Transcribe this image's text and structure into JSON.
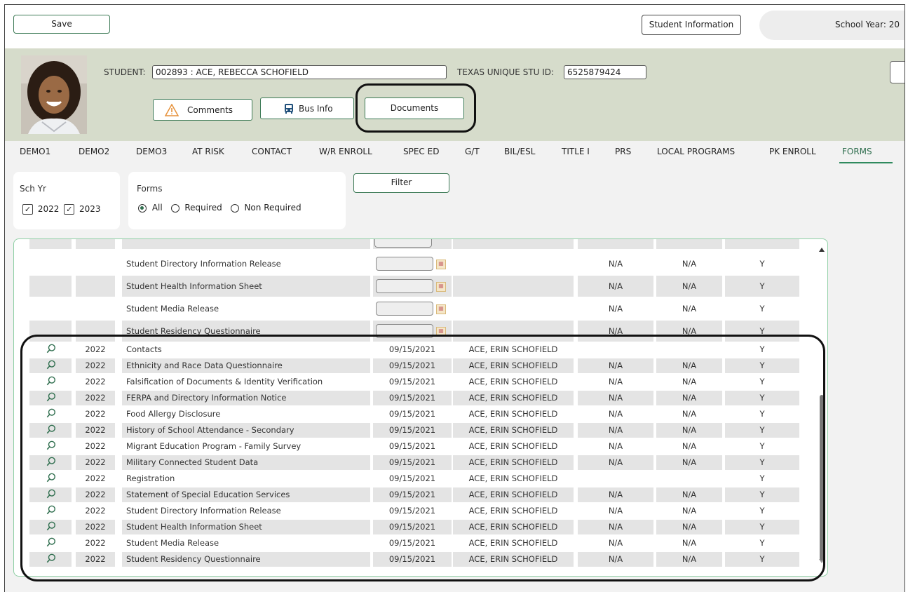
{
  "toolbar": {
    "save_label": "Save",
    "student_info_label": "Student Information",
    "school_year_text": "School Year: 20"
  },
  "student": {
    "student_label": "STUDENT:",
    "student_value": "002893 : ACE, REBECCA SCHOFIELD",
    "unique_id_label": "TEXAS UNIQUE STU ID:",
    "unique_id_value": "6525879424",
    "comments_label": "Comments",
    "bus_info_label": "Bus Info",
    "documents_label": "Documents"
  },
  "tabs": [
    "DEMO1",
    "DEMO2",
    "DEMO3",
    "AT RISK",
    "CONTACT",
    "W/R ENROLL",
    "SPEC ED",
    "G/T",
    "BIL/ESL",
    "TITLE I",
    "PRS",
    "LOCAL PROGRAMS",
    "PK ENROLL",
    "FORMS"
  ],
  "active_tab": "FORMS",
  "filters": {
    "sch_yr_label": "Sch Yr",
    "years": [
      {
        "label": "2022",
        "checked": true
      },
      {
        "label": "2023",
        "checked": true
      }
    ],
    "forms_label": "Forms",
    "form_options": [
      {
        "label": "All",
        "selected": true
      },
      {
        "label": "Required",
        "selected": false
      },
      {
        "label": "Non Required",
        "selected": false
      }
    ],
    "filter_button": "Filter"
  },
  "top_rows": [
    {
      "form": "Student Directory Information Release",
      "col1": "N/A",
      "col2": "N/A",
      "col3": "Y"
    },
    {
      "form": "Student Health Information Sheet",
      "col1": "N/A",
      "col2": "N/A",
      "col3": "Y"
    },
    {
      "form": "Student Media Release",
      "col1": "N/A",
      "col2": "N/A",
      "col3": "Y"
    },
    {
      "form": "Student Residency Questionnaire",
      "col1": "N/A",
      "col2": "N/A",
      "col3": "Y"
    }
  ],
  "rows": [
    {
      "year": "2022",
      "form": "Contacts",
      "date": "09/15/2021",
      "by": "ACE, ERIN SCHOFIELD",
      "col1": "",
      "col2": "",
      "col3": "Y"
    },
    {
      "year": "2022",
      "form": "Ethnicity and Race Data Questionnaire",
      "date": "09/15/2021",
      "by": "ACE, ERIN SCHOFIELD",
      "col1": "N/A",
      "col2": "N/A",
      "col3": "Y"
    },
    {
      "year": "2022",
      "form": "Falsification of Documents & Identity Verification",
      "date": "09/15/2021",
      "by": "ACE, ERIN SCHOFIELD",
      "col1": "N/A",
      "col2": "N/A",
      "col3": "Y"
    },
    {
      "year": "2022",
      "form": "FERPA and Directory Information Notice",
      "date": "09/15/2021",
      "by": "ACE, ERIN SCHOFIELD",
      "col1": "N/A",
      "col2": "N/A",
      "col3": "Y"
    },
    {
      "year": "2022",
      "form": "Food Allergy Disclosure",
      "date": "09/15/2021",
      "by": "ACE, ERIN SCHOFIELD",
      "col1": "N/A",
      "col2": "N/A",
      "col3": "Y"
    },
    {
      "year": "2022",
      "form": "History of School Attendance - Secondary",
      "date": "09/15/2021",
      "by": "ACE, ERIN SCHOFIELD",
      "col1": "N/A",
      "col2": "N/A",
      "col3": "Y"
    },
    {
      "year": "2022",
      "form": "Migrant Education Program - Family Survey",
      "date": "09/15/2021",
      "by": "ACE, ERIN SCHOFIELD",
      "col1": "N/A",
      "col2": "N/A",
      "col3": "Y"
    },
    {
      "year": "2022",
      "form": "Military Connected Student Data",
      "date": "09/15/2021",
      "by": "ACE, ERIN SCHOFIELD",
      "col1": "N/A",
      "col2": "N/A",
      "col3": "Y"
    },
    {
      "year": "2022",
      "form": "Registration",
      "date": "09/15/2021",
      "by": "ACE, ERIN SCHOFIELD",
      "col1": "",
      "col2": "",
      "col3": "Y"
    },
    {
      "year": "2022",
      "form": "Statement of Special Education Services",
      "date": "09/15/2021",
      "by": "ACE, ERIN SCHOFIELD",
      "col1": "N/A",
      "col2": "N/A",
      "col3": "Y"
    },
    {
      "year": "2022",
      "form": "Student Directory Information Release",
      "date": "09/15/2021",
      "by": "ACE, ERIN SCHOFIELD",
      "col1": "N/A",
      "col2": "N/A",
      "col3": "Y"
    },
    {
      "year": "2022",
      "form": "Student Health Information Sheet",
      "date": "09/15/2021",
      "by": "ACE, ERIN SCHOFIELD",
      "col1": "N/A",
      "col2": "N/A",
      "col3": "Y"
    },
    {
      "year": "2022",
      "form": "Student Media Release",
      "date": "09/15/2021",
      "by": "ACE, ERIN SCHOFIELD",
      "col1": "N/A",
      "col2": "N/A",
      "col3": "Y"
    },
    {
      "year": "2022",
      "form": "Student Residency Questionnaire",
      "date": "09/15/2021",
      "by": "ACE, ERIN SCHOFIELD",
      "col1": "N/A",
      "col2": "N/A",
      "col3": "Y"
    }
  ],
  "colors": {
    "accent": "#3d7a56",
    "header_bg": "#d6dccb",
    "active_tab": "#2f6e4e",
    "grid_border": "#8fcfa5"
  }
}
